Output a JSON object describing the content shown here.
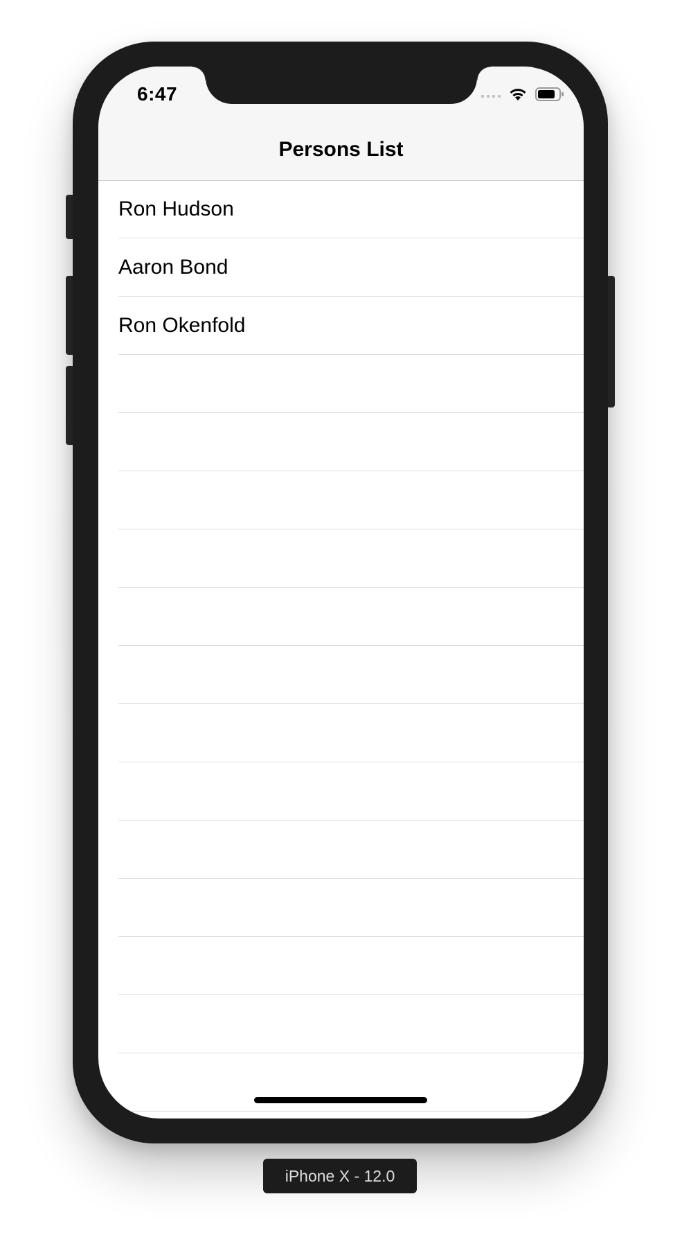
{
  "status_bar": {
    "time": "6:47"
  },
  "nav": {
    "title": "Persons List"
  },
  "persons": [
    {
      "name": "Ron Hudson"
    },
    {
      "name": "Aaron Bond"
    },
    {
      "name": "Ron Okenfold"
    }
  ],
  "empty_rows": 13,
  "device_label": "iPhone X - 12.0",
  "icons": {
    "signal": "cellular-signal-icon",
    "wifi": "wifi-icon",
    "battery": "battery-icon"
  }
}
